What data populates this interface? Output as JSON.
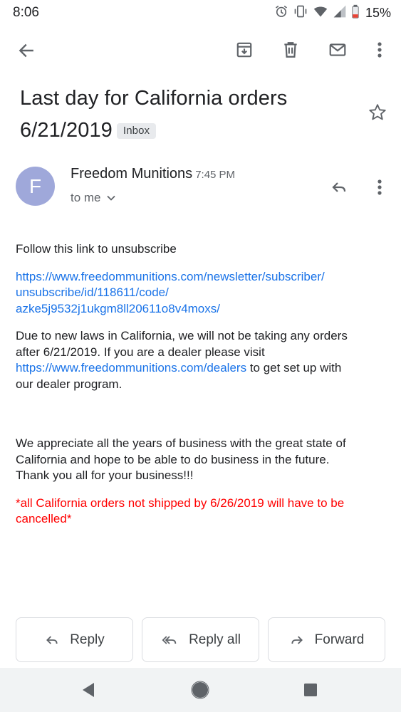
{
  "status_bar": {
    "time": "8:06",
    "battery": "15%",
    "battery_color": "#ea4335"
  },
  "toolbar": {
    "icons": [
      "back-arrow-icon",
      "archive-icon",
      "delete-icon",
      "mark-unread-icon",
      "more-vert-icon"
    ]
  },
  "email": {
    "subject": "Last day for California orders 6/21/2019",
    "label": "Inbox",
    "sender_initial": "F",
    "sender_name": "Freedom Munitions",
    "time": "7:45 PM",
    "recipient": "to me",
    "body": {
      "unsubscribe_text": "Follow this link to unsubscribe",
      "unsubscribe_link_lines": [
        "https://www.freedommunitions.com/newsletter/subscriber/",
        "unsubscribe/id/118611/code/",
        "azke5j9532j1ukgm8ll20611o8v4moxs/"
      ],
      "notice_line1": "Due to new laws in California, we will not be taking any orders",
      "notice_line2": "after 6/21/2019.  If you are a dealer please visit",
      "dealers_link": "https://www.freedommunitions.com/dealers",
      "notice_after_link": " to get set up with",
      "notice_line4": "our dealer program.",
      "thanks_line1": "We appreciate all the years of business with the great state of",
      "thanks_line2": "California and hope to be able to do business in the future.",
      "thanks_line3": "Thank you all for your business!!!",
      "warning_line1": "*all California orders not shipped by 6/26/2019 will have to be",
      "warning_line2": "cancelled*",
      "warning_color": "#ff0000"
    }
  },
  "actions": {
    "reply": "Reply",
    "reply_all": "Reply all",
    "forward": "Forward"
  },
  "colors": {
    "avatar": "#9fa8da",
    "link": "#1a73e8",
    "icon": "#5f6368"
  }
}
